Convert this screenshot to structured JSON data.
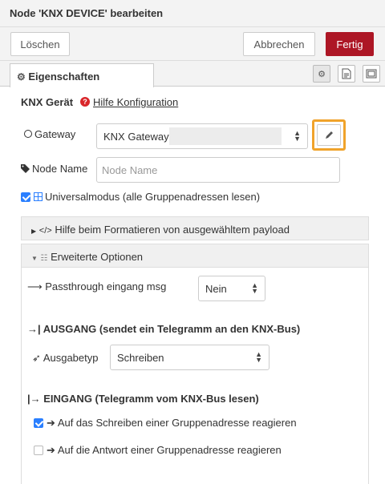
{
  "title": "Node 'KNX DEVICE' bearbeiten",
  "toolbar": {
    "delete": "Löschen",
    "cancel": "Abbrechen",
    "done": "Fertig"
  },
  "tabs": {
    "properties": "Eigenschaften"
  },
  "knx_device": {
    "label": "KNX Gerät",
    "help": "Hilfe Konfiguration"
  },
  "gateway": {
    "label": "Gateway",
    "value": "KNX Gateway"
  },
  "node_name": {
    "label": "Node Name",
    "placeholder": "Node Name"
  },
  "universal_mode": {
    "label": "Universalmodus (alle Gruppenadressen lesen)",
    "checked": true
  },
  "help_format": {
    "label": "Hilfe beim Formatieren von ausgewähltem payload"
  },
  "advanced": {
    "label": "Erweiterte Optionen"
  },
  "passthrough": {
    "label": "Passthrough eingang msg",
    "value": "Nein"
  },
  "output": {
    "heading": "AUSGANG (sendet ein Telegramm an den KNX-Bus)",
    "type_label": "Ausgabetyp",
    "type_value": "Schreiben"
  },
  "input": {
    "heading": "EINGANG (Telegramm vom KNX-Bus lesen)",
    "react_write": {
      "label": "Auf das Schreiben einer Gruppenadresse reagieren",
      "checked": true
    },
    "react_response": {
      "label": "Auf die Antwort einer Gruppenadresse reagieren",
      "checked": false
    }
  },
  "colors": {
    "primary": "#ad1625",
    "highlight": "#f0a32b",
    "checkbox": "#2a7fff",
    "help_icon": "#d9262a"
  }
}
